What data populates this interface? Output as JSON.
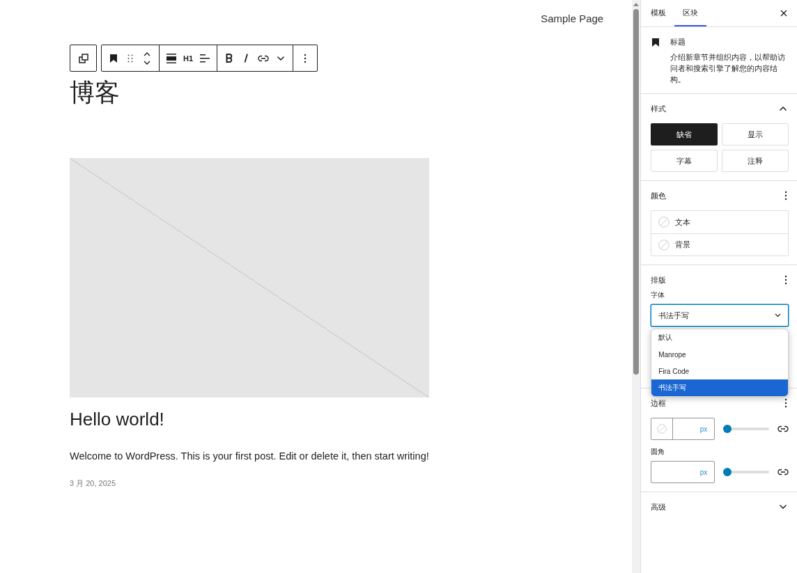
{
  "editor": {
    "nav_link": "Sample Page",
    "toolbar": {
      "heading_level": "H1"
    },
    "site_title": "博客",
    "post": {
      "title": "Hello world!",
      "excerpt": "Welcome to WordPress. This is your first post. Edit or delete it, then start writing!",
      "date": "3 月 20, 2025"
    }
  },
  "sidebar": {
    "tabs": [
      {
        "label": "模板",
        "selected": false
      },
      {
        "label": "区块",
        "selected": true
      }
    ],
    "block": {
      "title": "标题",
      "description": "介绍新章节并组织内容，以帮助访问者和搜索引擎了解您的内容结构。"
    },
    "styles": {
      "title": "样式",
      "expanded": true,
      "options": [
        {
          "label": "缺省",
          "selected": true
        },
        {
          "label": "显示",
          "selected": false
        },
        {
          "label": "字幕",
          "selected": false
        },
        {
          "label": "注释",
          "selected": false
        }
      ]
    },
    "color": {
      "title": "颜色",
      "items": [
        {
          "label": "文本"
        },
        {
          "label": "背景"
        }
      ]
    },
    "typography": {
      "title": "排版",
      "font_label": "字体",
      "font_value": "书法手写",
      "dropdown_open": true,
      "options": [
        {
          "label": "默认",
          "selected": false
        },
        {
          "label": "Manrope",
          "selected": false
        },
        {
          "label": "Fira Code",
          "selected": false
        },
        {
          "label": "书法手写",
          "selected": true
        }
      ]
    },
    "border": {
      "title": "边框",
      "width": {
        "unit": "px",
        "level": 0
      },
      "radius": {
        "label": "圆角",
        "unit": "px",
        "level": 0
      }
    },
    "advanced": {
      "title": "高级",
      "expanded": false
    }
  }
}
